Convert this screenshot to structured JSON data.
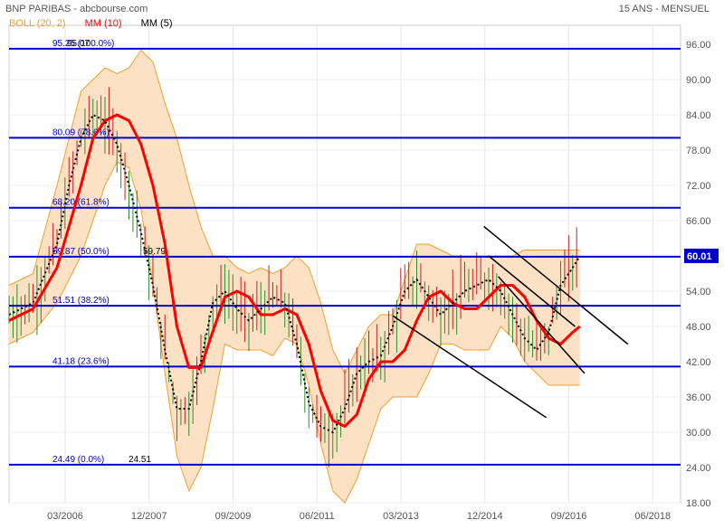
{
  "header": {
    "title": "BNP PARIBAS - abcbourse.com",
    "timeframe": "15 ANS - MENSUEL",
    "legend": [
      {
        "label": "BOLL (20, 2)",
        "color": "#f0a030"
      },
      {
        "label": "MM (10)",
        "color": "#ff0000"
      },
      {
        "label": "MM (5)",
        "color": "#000000"
      }
    ]
  },
  "colors": {
    "boll_fill": "#fce1c4",
    "boll_line": "#f0a030",
    "mm10": "#ff0000",
    "mm5": "#000000",
    "fib_line": "#0000cc",
    "fib_label": "#0000cc",
    "up_candle": "#2e8b2e",
    "down_candle": "#cc2020",
    "price_tag_bg": "#0000cc",
    "price_tag_text": "#ffffff",
    "trendline": "#000000",
    "axis_text": "#555555"
  },
  "chart_data": {
    "type": "line",
    "title": "BNP PARIBAS",
    "timeframe": "15 ANS - MENSUEL",
    "ylim": [
      18,
      98
    ],
    "xlim": [
      2005.0,
      2019.0
    ],
    "y_ticks": [
      18,
      24,
      30,
      36,
      42,
      48,
      54,
      60,
      66,
      72,
      78,
      84,
      90,
      96
    ],
    "y_tick_labels": [
      "18.00",
      "24.00",
      "30.00",
      "36.00",
      "42.00",
      "48.00",
      "54.00",
      "60.00",
      "66.00",
      "72.00",
      "78.00",
      "84.00",
      "90.00",
      "96.00"
    ],
    "x_ticks": [
      {
        "t": 2006.17,
        "label": "03/2006"
      },
      {
        "t": 2007.92,
        "label": "12/2007"
      },
      {
        "t": 2009.67,
        "label": "09/2009"
      },
      {
        "t": 2011.42,
        "label": "06/2011"
      },
      {
        "t": 2013.17,
        "label": "03/2013"
      },
      {
        "t": 2014.92,
        "label": "12/2014"
      },
      {
        "t": 2016.67,
        "label": "09/2016"
      },
      {
        "t": 2018.42,
        "label": "06/2018"
      }
    ],
    "last_price": "60.01",
    "last_price_value": 60.01,
    "fib_levels": [
      {
        "value": 95.25,
        "label": "95.25",
        "pct": "(100.0%)",
        "extra": "95.07"
      },
      {
        "value": 80.09,
        "label": "80.09",
        "pct": "(78.6%)"
      },
      {
        "value": 68.2,
        "label": "68.20",
        "pct": "(61.8%)"
      },
      {
        "value": 59.87,
        "label": "59.87",
        "pct": "(50.0%)",
        "extra": "59.79"
      },
      {
        "value": 51.51,
        "label": "51.51",
        "pct": "(38.2%)"
      },
      {
        "value": 41.18,
        "label": "41.18",
        "pct": "(23.6%)"
      },
      {
        "value": 24.49,
        "label": "24.49",
        "pct": "(0.0%)",
        "extra": "24.51"
      }
    ],
    "series": [
      {
        "name": "MM (10)",
        "x": [
          2005.0,
          2005.5,
          2006.0,
          2006.5,
          2006.75,
          2007.0,
          2007.25,
          2007.5,
          2007.75,
          2008.0,
          2008.25,
          2008.5,
          2008.75,
          2009.0,
          2009.2,
          2009.5,
          2009.75,
          2010.0,
          2010.25,
          2010.5,
          2010.75,
          2011.0,
          2011.25,
          2011.5,
          2011.75,
          2012.0,
          2012.25,
          2012.5,
          2012.75,
          2013.0,
          2013.25,
          2013.5,
          2013.75,
          2014.0,
          2014.25,
          2014.5,
          2014.75,
          2015.0,
          2015.25,
          2015.5,
          2015.75,
          2016.0,
          2016.25,
          2016.5,
          2016.75,
          2016.9
        ],
        "values": [
          49,
          51,
          58,
          72,
          80,
          83,
          84,
          83,
          79,
          72,
          62,
          48,
          41,
          41,
          46,
          53,
          54,
          53,
          50,
          50,
          51,
          50,
          45,
          37,
          32,
          31,
          33,
          39,
          42,
          42,
          44,
          49,
          53,
          54,
          52,
          51,
          51,
          53,
          55,
          55,
          53,
          49,
          46,
          45,
          47,
          48
        ]
      },
      {
        "name": "MM (5)",
        "x": [
          2005.0,
          2005.5,
          2006.0,
          2006.25,
          2006.5,
          2006.75,
          2007.0,
          2007.25,
          2007.5,
          2007.75,
          2008.0,
          2008.25,
          2008.5,
          2008.75,
          2009.0,
          2009.25,
          2009.5,
          2009.75,
          2010.0,
          2010.25,
          2010.5,
          2010.75,
          2011.0,
          2011.25,
          2011.5,
          2011.75,
          2012.0,
          2012.25,
          2012.5,
          2012.75,
          2013.0,
          2013.25,
          2013.5,
          2013.75,
          2014.0,
          2014.25,
          2014.5,
          2014.75,
          2015.0,
          2015.25,
          2015.5,
          2015.75,
          2016.0,
          2016.25,
          2016.5,
          2016.75,
          2016.9
        ],
        "values": [
          50,
          52,
          62,
          72,
          80,
          84,
          83,
          79,
          72,
          64,
          55,
          44,
          34,
          34,
          42,
          52,
          54,
          51,
          49,
          51,
          53,
          52,
          45,
          35,
          31,
          30,
          34,
          40,
          42,
          43,
          48,
          54,
          56,
          53,
          50,
          52,
          54,
          55,
          56,
          54,
          50,
          46,
          44,
          47,
          55,
          58,
          60
        ]
      }
    ],
    "bollinger": {
      "upper": {
        "x": [
          2005.0,
          2005.5,
          2006.0,
          2006.5,
          2007.0,
          2007.25,
          2007.5,
          2007.75,
          2008.0,
          2008.25,
          2008.5,
          2008.75,
          2009.0,
          2009.25,
          2009.5,
          2009.75,
          2010.0,
          2010.25,
          2010.5,
          2010.75,
          2011.0,
          2011.25,
          2011.5,
          2011.75,
          2012.0,
          2012.25,
          2012.5,
          2012.75,
          2013.0,
          2013.25,
          2013.5,
          2013.75,
          2014.0,
          2014.25,
          2014.5,
          2014.75,
          2015.0,
          2015.25,
          2015.5,
          2015.75,
          2016.0,
          2016.25,
          2016.5,
          2016.75,
          2016.9
        ],
        "values": [
          55,
          57,
          72,
          88,
          92,
          91,
          92,
          95,
          93,
          86,
          80,
          72,
          65,
          60,
          60,
          58,
          57,
          58,
          57,
          58,
          60,
          58,
          52,
          44,
          40,
          44,
          48,
          50,
          50,
          56,
          62,
          62,
          61,
          60,
          60,
          60,
          60,
          60,
          60,
          61,
          61,
          61,
          61,
          61,
          61
        ]
      },
      "lower": {
        "x": [
          2005.0,
          2005.5,
          2006.0,
          2006.5,
          2007.0,
          2007.25,
          2007.5,
          2007.75,
          2008.0,
          2008.25,
          2008.5,
          2008.75,
          2009.0,
          2009.25,
          2009.5,
          2009.75,
          2010.0,
          2010.25,
          2010.5,
          2010.75,
          2011.0,
          2011.25,
          2011.5,
          2011.75,
          2012.0,
          2012.25,
          2012.5,
          2012.75,
          2013.0,
          2013.25,
          2013.5,
          2013.75,
          2014.0,
          2014.25,
          2014.5,
          2014.75,
          2015.0,
          2015.25,
          2015.5,
          2015.75,
          2016.0,
          2016.25,
          2016.5,
          2016.75,
          2016.9
        ],
        "values": [
          45,
          47,
          52,
          60,
          72,
          76,
          75,
          68,
          55,
          40,
          26,
          20,
          24,
          34,
          45,
          44,
          44,
          44,
          43,
          46,
          45,
          38,
          28,
          20,
          18,
          22,
          28,
          34,
          36,
          36,
          36,
          40,
          45,
          45,
          44,
          44,
          44,
          48,
          46,
          42,
          40,
          38,
          38,
          38,
          38
        ]
      }
    },
    "trendlines": [
      {
        "x": [
          2015.2,
          2017.0
        ],
        "values": [
          56.5,
          40.0
        ]
      },
      {
        "x": [
          2013.0,
          2016.2
        ],
        "values": [
          49.8,
          32.5
        ]
      },
      {
        "x": [
          2014.9,
          2017.9
        ],
        "values": [
          65.0,
          45.0
        ]
      },
      {
        "x": [
          2015.0,
          2016.8
        ],
        "values": [
          60.0,
          48.0
        ]
      }
    ]
  }
}
